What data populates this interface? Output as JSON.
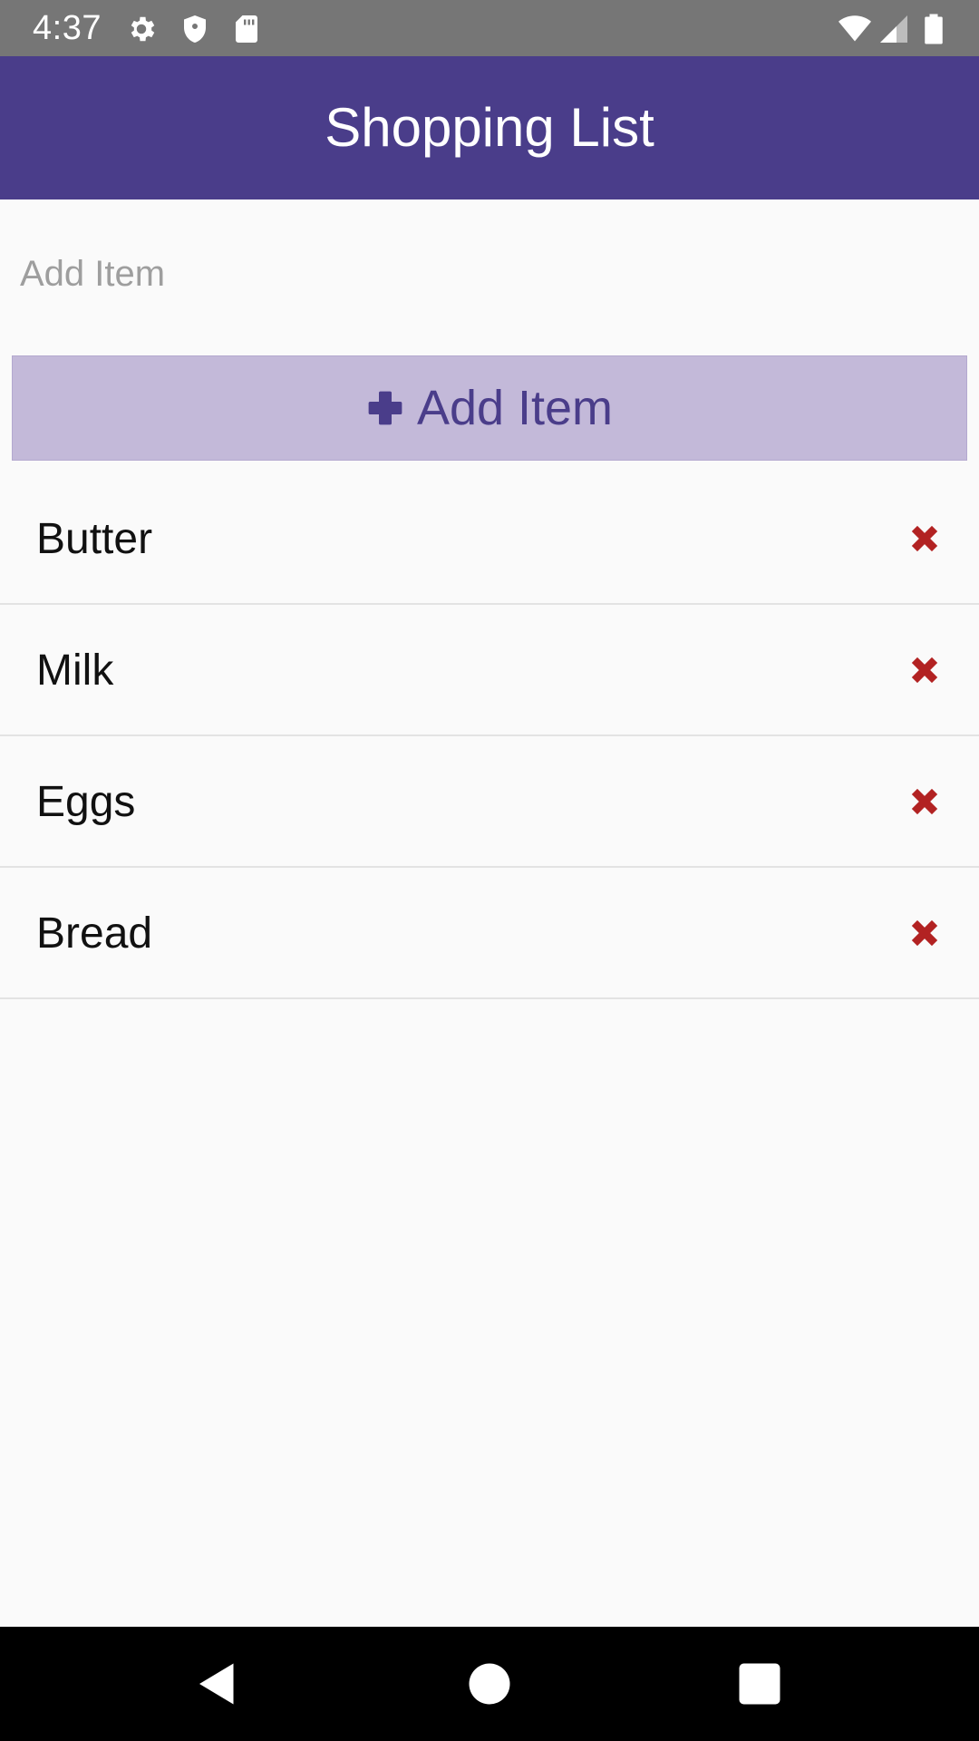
{
  "status_bar": {
    "time": "4:37",
    "icons_left": [
      "gear-icon",
      "shield-icon",
      "sd-card-icon"
    ],
    "icons_right": [
      "wifi-icon",
      "signal-icon",
      "battery-icon"
    ]
  },
  "app_bar": {
    "title": "Shopping List",
    "color": "#4a3d8a"
  },
  "add_item": {
    "input_value": "",
    "placeholder": "Add Item",
    "button_label": "Add Item",
    "button_icon": "plus-icon",
    "button_color": "#c3b9d9"
  },
  "items": [
    {
      "label": "Butter"
    },
    {
      "label": "Milk"
    },
    {
      "label": "Eggs"
    },
    {
      "label": "Bread"
    }
  ],
  "delete_icon": "close-icon",
  "delete_color": "#b22222",
  "nav_bar": {
    "buttons": [
      "back-icon",
      "home-icon",
      "recents-icon"
    ]
  }
}
